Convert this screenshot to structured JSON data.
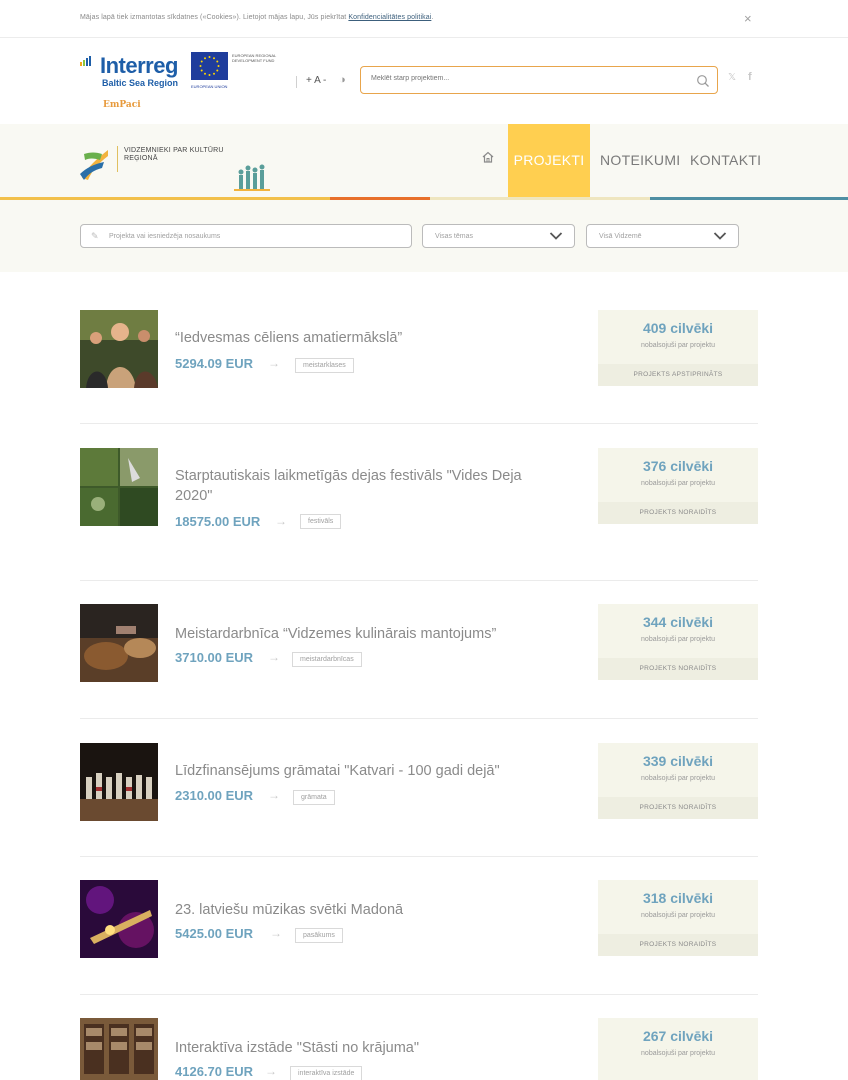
{
  "cookie": {
    "text": "Mājas lapā tiek izmantotas sīkdatnes («Cookies»). Lietojot mājas lapu, Jūs piekrītat ",
    "link": "Konfidencialitātes politikai",
    "text_end": ".",
    "close": "×"
  },
  "header": {
    "interreg_word": "Interreg",
    "interreg_sub": "Baltic Sea Region",
    "eu_union": "EUROPEAN UNION",
    "eu_fund": "EUROPEAN REGIONAL DEVELOPMENT FUND",
    "project_logo": "EmPaci",
    "font_ctrl": "+ A -",
    "search_placeholder": "Meklēt starp projektiem...",
    "twitter": "𝕏",
    "facebook": "f"
  },
  "site": {
    "title_line1": "VIDZEMNIEKI PAR KULTŪRU",
    "title_line2": "REĢIONĀ"
  },
  "nav": {
    "items": [
      {
        "label": "PROJEKTI",
        "active": true
      },
      {
        "label": "NOTEIKUMI",
        "active": false
      },
      {
        "label": "KONTAKTI",
        "active": false
      }
    ]
  },
  "filters": {
    "search_placeholder": "Projekta vai iesniedzēja nosaukums",
    "topic": "Visas tēmas",
    "region": "Visā Vidzemē"
  },
  "votes_label": "nobalsojuši par projektu",
  "projects": [
    {
      "title": "“Iedvesmas cēliens amatiermākslā”",
      "price": "5294.09 EUR",
      "tag": "meistarklases",
      "votes": "409 cilvēki",
      "status": "PROJEKTS APSTIPRINĀTS"
    },
    {
      "title": "Starptautiskais laikmetīgās dejas festivāls \"Vides Deja 2020\"",
      "price": "18575.00 EUR",
      "tag": "festivāls",
      "votes": "376 cilvēki",
      "status": "PROJEKTS NORAIDĪTS"
    },
    {
      "title": "Meistardarbnīca “Vidzemes kulinārais mantojums”",
      "price": "3710.00 EUR",
      "tag": "meistardarbnīcas",
      "votes": "344 cilvēki",
      "status": "PROJEKTS NORAIDĪTS"
    },
    {
      "title": "Līdzfinansējums grāmatai \"Katvari - 100 gadi dejā\"",
      "price": "2310.00 EUR",
      "tag": "grāmata",
      "votes": "339 cilvēki",
      "status": "PROJEKTS NORAIDĪTS"
    },
    {
      "title": "23. latviešu mūzikas svētki Madonā",
      "price": "5425.00 EUR",
      "tag": "pasākums",
      "votes": "318 cilvēki",
      "status": "PROJEKTS NORAIDĪTS"
    },
    {
      "title": "Interaktīva izstāde \"Stāsti no krājuma\"",
      "price": "4126.70 EUR",
      "tag": "interaktīva izstāde",
      "votes": "267 cilvēki",
      "status": ""
    }
  ]
}
